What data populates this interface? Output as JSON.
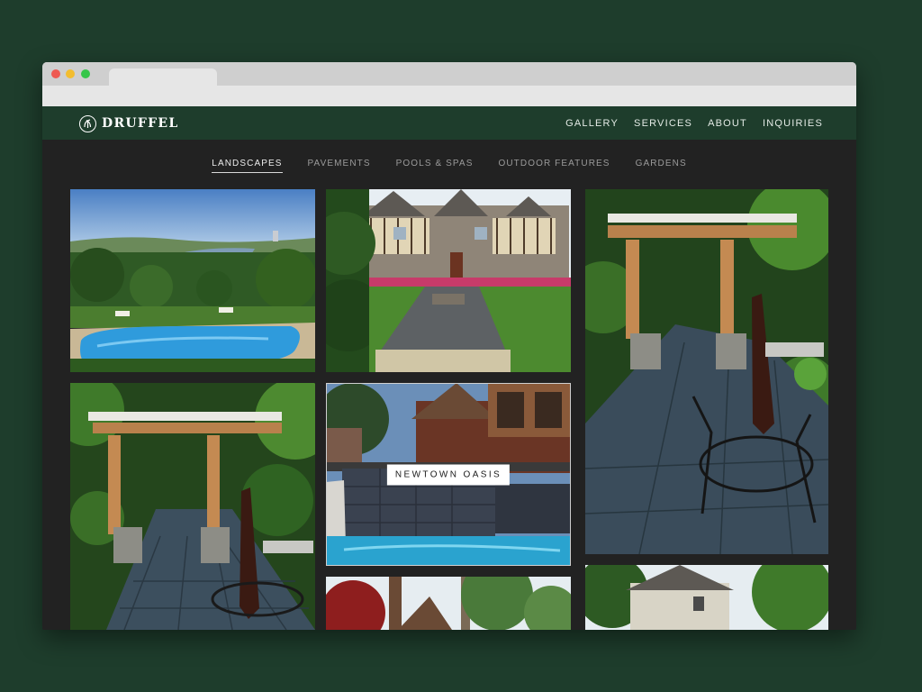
{
  "brand": {
    "name": "DRUFFEL",
    "logo_icon": "leaf-monogram-icon"
  },
  "main_nav": [
    {
      "label": "GALLERY"
    },
    {
      "label": "SERVICES"
    },
    {
      "label": "ABOUT"
    },
    {
      "label": "INQUIRIES"
    }
  ],
  "sub_nav": [
    {
      "label": "LANDSCAPES",
      "active": true
    },
    {
      "label": "PAVEMENTS"
    },
    {
      "label": "POOLS & SPAS"
    },
    {
      "label": "OUTDOOR FEATURES"
    },
    {
      "label": "GARDENS"
    }
  ],
  "gallery": {
    "hover_caption": "NEWTOWN OASIS"
  },
  "colors": {
    "brand_green": "#1e3d2c",
    "page_background": "#222222",
    "caption_background": "#ffffff"
  }
}
